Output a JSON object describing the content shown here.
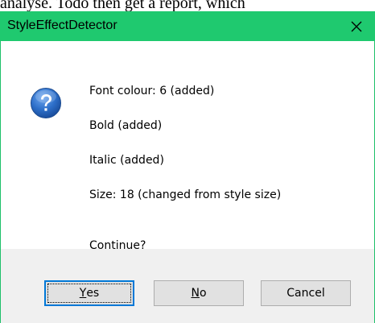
{
  "background": {
    "text": "analyse. Todo then get a report, which"
  },
  "window": {
    "title": "StyleEffectDetector",
    "close_glyph": "✕",
    "titlebar_color": "#1fc96f"
  },
  "message": {
    "icon": "question-icon",
    "lines": [
      "Font colour: 6  (added)",
      "Bold  (added)",
      "Italic  (added)",
      "Size: 18  (changed from style size)",
      "Continue?"
    ]
  },
  "buttons": {
    "yes": {
      "mnemonic": "Y",
      "rest": "es"
    },
    "no": {
      "mnemonic": "N",
      "rest": "o"
    },
    "cancel": {
      "label": "Cancel"
    }
  }
}
